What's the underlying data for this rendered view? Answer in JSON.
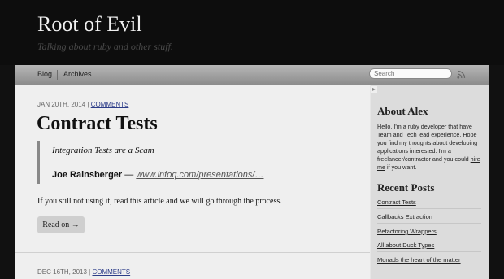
{
  "header": {
    "site_title": "Root of Evil",
    "tagline": "Talking about ruby and other stuff."
  },
  "nav": {
    "items": [
      {
        "label": "Blog"
      },
      {
        "label": "Archives"
      }
    ],
    "search_placeholder": "Search",
    "rss_icon": "rss-icon"
  },
  "posts": [
    {
      "date": "JAN 20TH, 2014",
      "separator": "|",
      "comments_label": "COMMENTS",
      "title": "Contract Tests",
      "quote_text": "Integration Tests are a Scam",
      "quote_author": "Joe Rainsberger",
      "quote_dash": "—",
      "quote_link": "www.infoq.com/presentations/…",
      "paragraph": "If you still not using it, read this article and we will go through the process.",
      "read_on": "Read on →"
    },
    {
      "date": "DEC 16TH, 2013",
      "separator": "|",
      "comments_label": "COMMENTS"
    }
  ],
  "sidebar": {
    "about_title": "About Alex",
    "about_text": "Hello, I'm a ruby developer that have Team and Tech lead experience. Hope you find my thoughts about developing applications interested. I'm a freelancer/contractor and you could ",
    "about_link": "hire me",
    "about_end": " if you want.",
    "recent_title": "Recent Posts",
    "recent_posts": [
      "Contract Tests",
      "Callbacks Extraction",
      "Refactoring Wrappers",
      "All about Duck Types",
      "Monads the heart of the matter"
    ]
  }
}
